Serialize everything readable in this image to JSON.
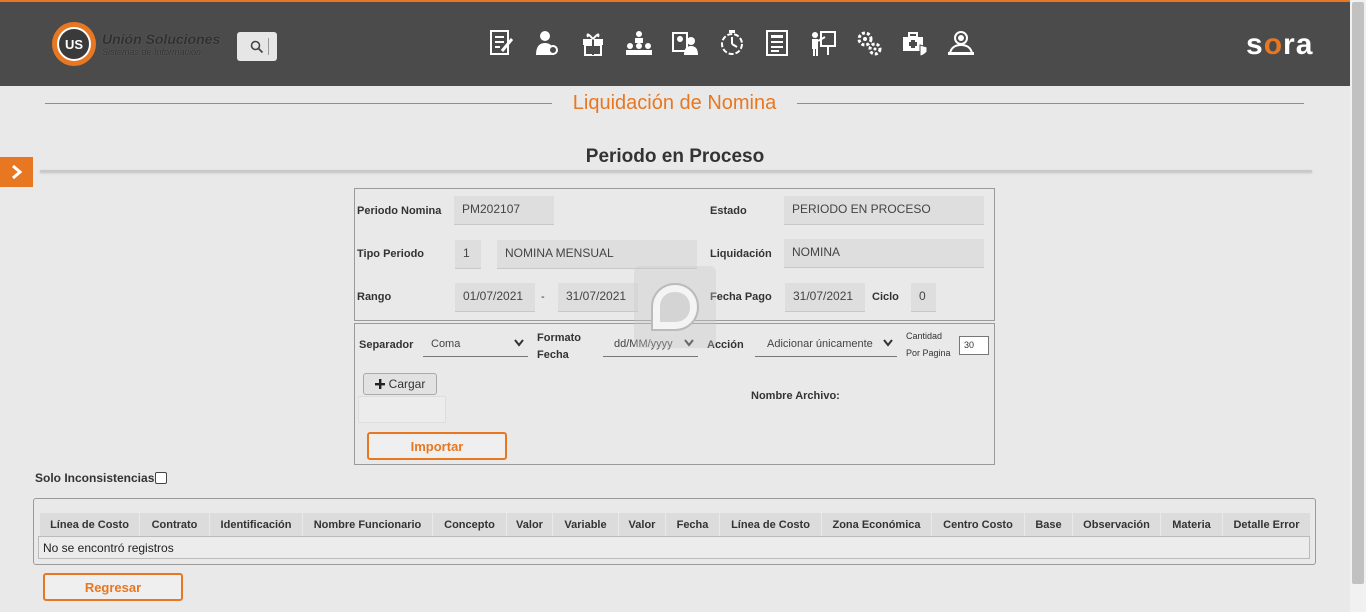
{
  "header": {
    "logo_title": "Unión Soluciones",
    "logo_subtitle": "Sistemas de Información",
    "logo_mark": "US",
    "brand_prefix": "s",
    "brand_o": "o",
    "brand_suffix": "ra",
    "nav_icons": [
      "document-edit-icon",
      "user-settings-icon",
      "gift-icon",
      "hierarchy-icon",
      "user-card-icon",
      "timer-icon",
      "form-icon",
      "presentation-icon",
      "gears-icon",
      "medical-bag-icon",
      "user-search-icon"
    ]
  },
  "page": {
    "title": "Liquidación de Nomina",
    "subtitle": "Periodo en Proceso"
  },
  "period": {
    "periodo_nomina_label": "Periodo Nomina",
    "periodo_nomina_value": "PM202107",
    "estado_label": "Estado",
    "estado_value": "PERIODO EN PROCESO",
    "tipo_periodo_label": "Tipo Periodo",
    "tipo_periodo_code": "1",
    "tipo_periodo_value": "NOMINA MENSUAL",
    "liquidacion_label": "Liquidación",
    "liquidacion_value": "NOMINA",
    "rango_label": "Rango",
    "rango_desde": "01/07/2021",
    "rango_sep": "-",
    "rango_hasta": "31/07/2021",
    "fecha_pago_label": "Fecha Pago",
    "fecha_pago_value": "31/07/2021",
    "ciclo_label": "Ciclo",
    "ciclo_value": "0"
  },
  "import": {
    "separador_label": "Separador",
    "separador_value": "Coma",
    "formato_label_1": "Formato",
    "formato_label_2": "Fecha",
    "formato_value": "dd/MM/yyyy",
    "accion_label": "Acción",
    "accion_value": "Adicionar únicamente",
    "cantidad_label_1": "Cantidad",
    "cantidad_label_2": "Por Pagina",
    "cantidad_value": "30",
    "cargar_label": "Cargar",
    "nombre_archivo_label": "Nombre Archivo:",
    "importar_label": "Importar"
  },
  "filter": {
    "solo_inconsistencias_label": "Solo Inconsistencias",
    "checked": false
  },
  "table": {
    "columns": [
      "Línea de Costo",
      "Contrato",
      "Identificación",
      "Nombre Funcionario",
      "Concepto",
      "Valor",
      "Variable",
      "Valor",
      "Fecha",
      "Línea de Costo",
      "Zona Económica",
      "Centro Costo",
      "Base",
      "Observación",
      "Materia",
      "Detalle Error"
    ],
    "empty_message": "No se encontró registros"
  },
  "footer": {
    "regresar_label": "Regresar"
  },
  "colors": {
    "accent": "#e87722",
    "header_bg": "#4b4b4b",
    "page_bg": "#e9e9e9"
  }
}
